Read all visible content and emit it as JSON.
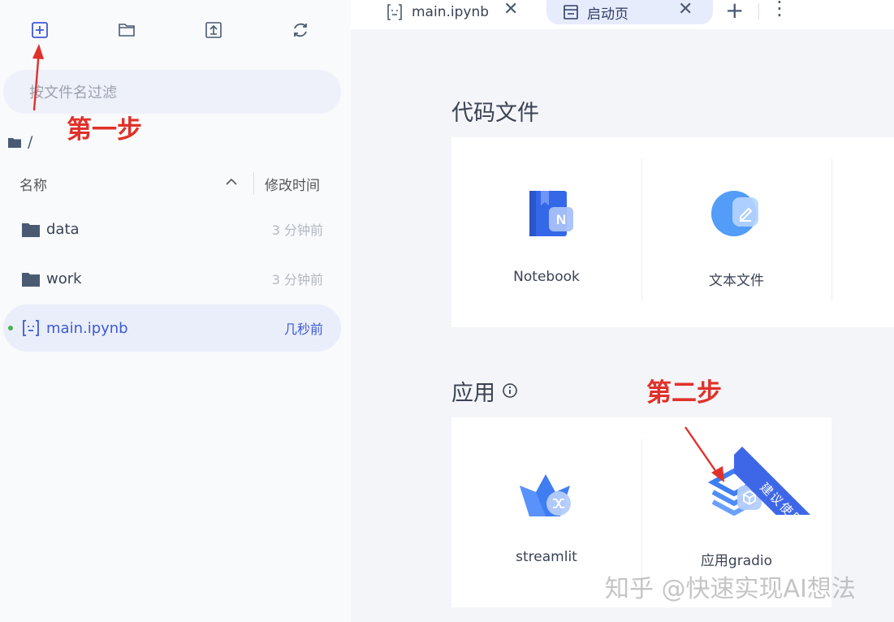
{
  "sidebar": {
    "toolbar": {
      "new_icon": "plus-square-icon",
      "folder_icon": "new-folder-icon",
      "upload_icon": "upload-icon",
      "refresh_icon": "refresh-icon"
    },
    "filter_placeholder": "按文件名过滤",
    "path": "/",
    "columns": {
      "name": "名称",
      "modified": "修改时间"
    },
    "files": [
      {
        "name": "data",
        "modified": "3 分钟前",
        "icon": "folder-icon"
      },
      {
        "name": "work",
        "modified": "3 分钟前",
        "icon": "folder-icon"
      },
      {
        "name": "main.ipynb",
        "modified": "几秒前",
        "icon": "notebook-file-icon",
        "selected": true
      }
    ]
  },
  "tabs": [
    {
      "label": "main.ipynb",
      "icon": "notebook-file-icon"
    },
    {
      "label": "启动页",
      "icon": "launcher-icon",
      "active": true
    }
  ],
  "launcher": {
    "code_section": "代码文件",
    "code_cards": [
      "Notebook",
      "文本文件"
    ],
    "apps_section": "应用",
    "app_cards": [
      "streamlit",
      "应用gradio"
    ],
    "ribbon": "建议使用"
  },
  "annotations": {
    "step1": "第一步",
    "step2": "第二步",
    "arrow_color": "#e0312a"
  },
  "watermark": "知乎 @快速实现AI想法",
  "colors": {
    "accent": "#3c5ad4",
    "ribbon": "#3e67e8"
  }
}
